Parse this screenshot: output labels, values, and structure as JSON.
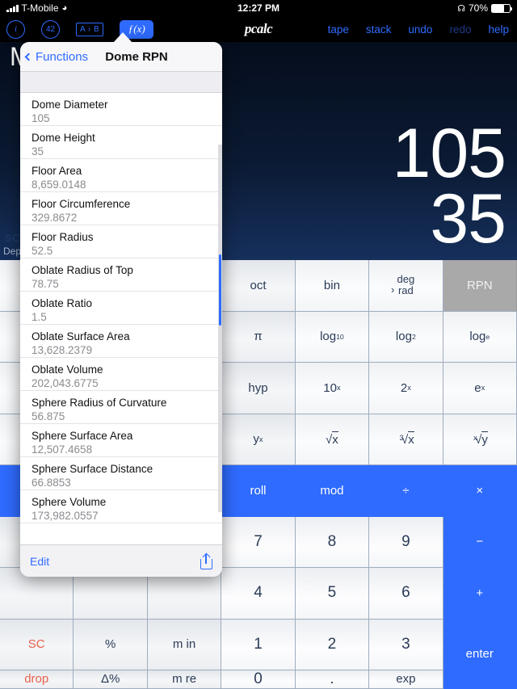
{
  "status_bar": {
    "carrier": "T-Mobile",
    "signal_icon": "signal-bars-icon",
    "wifi_icon": "wifi-icon",
    "time": "12:27 PM",
    "bluetooth_icon": "bluetooth-icon",
    "battery_percent": "70%",
    "battery_icon": "battery-icon"
  },
  "toolbar": {
    "info_label": "i",
    "constants_label": "42",
    "convert_label": "A › B",
    "functions_label": "ƒ(x)",
    "app_title": "pcalc",
    "links": [
      {
        "label": "tape",
        "enabled": true
      },
      {
        "label": "stack",
        "enabled": true
      },
      {
        "label": "undo",
        "enabled": true
      },
      {
        "label": "redo",
        "enabled": false
      },
      {
        "label": "help",
        "enabled": true
      }
    ]
  },
  "display": {
    "memory_indicator": "M",
    "mode_label": "SCI",
    "register_label": "Dep",
    "stack": [
      "105",
      "35"
    ]
  },
  "popover": {
    "back_label": "Functions",
    "title": "Dome RPN",
    "edit_label": "Edit",
    "share_icon": "share-icon",
    "back_icon": "chevron-left-icon",
    "rows": [
      {
        "label": "Dome Diameter",
        "value": "105"
      },
      {
        "label": "Dome Height",
        "value": "35"
      },
      {
        "label": "Floor Area",
        "value": "8,659.0148"
      },
      {
        "label": "Floor Circumference",
        "value": "329.8672"
      },
      {
        "label": "Floor Radius",
        "value": "52.5"
      },
      {
        "label": "Oblate Radius of Top",
        "value": "78.75"
      },
      {
        "label": "Oblate Ratio",
        "value": "1.5"
      },
      {
        "label": "Oblate Surface Area",
        "value": "13,628.2379"
      },
      {
        "label": "Oblate Volume",
        "value": "202,043.6775"
      },
      {
        "label": "Sphere Radius of Curvature",
        "value": "56.875"
      },
      {
        "label": "Sphere Surface Area",
        "value": "12,507.4658"
      },
      {
        "label": "Sphere Surface Distance",
        "value": "66.8853"
      },
      {
        "label": "Sphere Volume",
        "value": "173,982.0557"
      }
    ]
  },
  "keypad": {
    "rows": [
      [
        {
          "label": "",
          "style": "light"
        },
        {
          "label": "",
          "style": "light"
        },
        {
          "label": "",
          "style": "light"
        },
        {
          "label": "oct",
          "style": "key"
        },
        {
          "label": "bin",
          "style": "light"
        },
        {
          "label": "deg/rad",
          "style": "light",
          "kind": "degrad",
          "top": "deg",
          "bottom": "rad"
        },
        {
          "label": "RPN",
          "style": "gray"
        }
      ],
      [
        {
          "label": "",
          "style": "light"
        },
        {
          "label": "",
          "style": "light"
        },
        {
          "label": "",
          "style": "light"
        },
        {
          "label": "π",
          "style": "key"
        },
        {
          "label": "log10",
          "style": "light",
          "kind": "logsub",
          "base": "log",
          "sub": "10"
        },
        {
          "label": "log2",
          "style": "light",
          "kind": "logsub",
          "base": "log",
          "sub": "2"
        },
        {
          "label": "loge",
          "style": "light",
          "kind": "logsub",
          "base": "log",
          "sub": "e"
        }
      ],
      [
        {
          "label": "",
          "style": "light"
        },
        {
          "label": "",
          "style": "light"
        },
        {
          "label": "",
          "style": "light"
        },
        {
          "label": "hyp",
          "style": "key"
        },
        {
          "label": "10^x",
          "style": "light",
          "kind": "sup",
          "base": "10",
          "sup": "x"
        },
        {
          "label": "2^x",
          "style": "light",
          "kind": "sup",
          "base": "2",
          "sup": "x"
        },
        {
          "label": "e^x",
          "style": "light",
          "kind": "sup",
          "base": "e",
          "sup": "x"
        }
      ],
      [
        {
          "label": "",
          "style": "light"
        },
        {
          "label": "",
          "style": "light"
        },
        {
          "label": "",
          "style": "light"
        },
        {
          "label": "y^x",
          "style": "key",
          "kind": "sup",
          "base": "y",
          "sup": "x"
        },
        {
          "label": "sqrt x",
          "style": "light",
          "kind": "root",
          "index": "",
          "radicand": "x"
        },
        {
          "label": "cube root x",
          "style": "light",
          "kind": "root",
          "index": "3",
          "radicand": "x"
        },
        {
          "label": "xth root y",
          "style": "light",
          "kind": "root",
          "index": "x",
          "radicand": "y"
        }
      ],
      [
        {
          "label": "",
          "style": "blue"
        },
        {
          "label": "",
          "style": "blue"
        },
        {
          "label": "",
          "style": "blue"
        },
        {
          "label": "roll",
          "style": "blue"
        },
        {
          "label": "mod",
          "style": "blue"
        },
        {
          "label": "÷",
          "style": "blue"
        },
        {
          "label": "×",
          "style": "blue"
        }
      ],
      [
        {
          "label": "",
          "style": "key"
        },
        {
          "label": "",
          "style": "key"
        },
        {
          "label": "",
          "style": "key"
        },
        {
          "label": "7",
          "style": "num"
        },
        {
          "label": "8",
          "style": "num"
        },
        {
          "label": "9",
          "style": "num"
        },
        {
          "label": "−",
          "style": "blue"
        }
      ],
      [
        {
          "label": "",
          "style": "key"
        },
        {
          "label": "",
          "style": "key"
        },
        {
          "label": "",
          "style": "key"
        },
        {
          "label": "4",
          "style": "num"
        },
        {
          "label": "5",
          "style": "num"
        },
        {
          "label": "6",
          "style": "num"
        },
        {
          "label": "+",
          "style": "blue"
        }
      ],
      [
        {
          "label": "SC",
          "style": "key red"
        },
        {
          "label": "%",
          "style": "key"
        },
        {
          "label": "m in",
          "style": "key"
        },
        {
          "label": "1",
          "style": "num"
        },
        {
          "label": "2",
          "style": "num"
        },
        {
          "label": "3",
          "style": "num"
        },
        {
          "label": "enter",
          "style": "blue",
          "rowspan": 2
        }
      ],
      [
        {
          "label": "drop",
          "style": "key red"
        },
        {
          "label": "Δ%",
          "style": "key"
        },
        {
          "label": "m re",
          "style": "key"
        },
        {
          "label": "0",
          "style": "num"
        },
        {
          "label": ".",
          "style": "num"
        },
        {
          "label": "exp",
          "style": "num small"
        }
      ]
    ]
  },
  "colors": {
    "accent_blue": "#2f6bff",
    "key_blue": "#3073f0",
    "red": "#e8604c",
    "display_dark": "#050d1c",
    "display_light": "#16305c",
    "rpn_gray": "#a9a9a9"
  }
}
